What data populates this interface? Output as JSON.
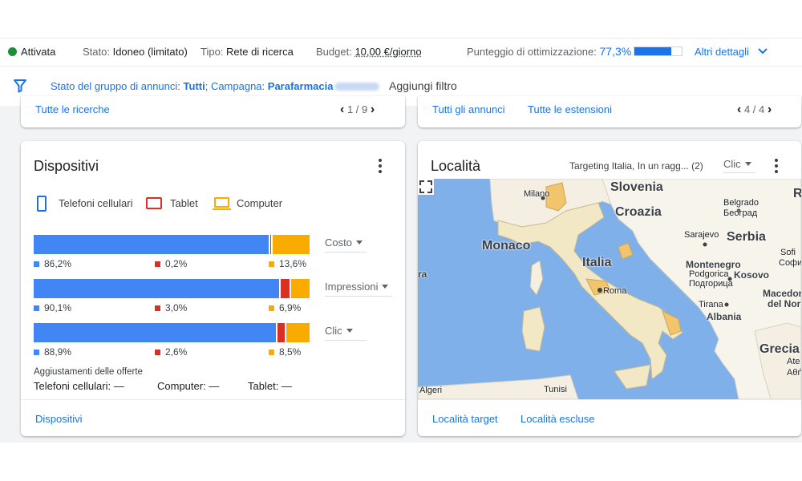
{
  "status_bar": {
    "status_label": "Attivata",
    "state_label": "Stato:",
    "state_value": "Idoneo (limitato)",
    "type_label": "Tipo:",
    "type_value": "Rete di ricerca",
    "budget_label": "Budget:",
    "budget_value": "10,00 €/giorno",
    "optimization_label": "Punteggio di ottimizzazione:",
    "optimization_value": "77,3%",
    "optimization_fraction": 0.773,
    "more_details": "Altri dettagli"
  },
  "filter_bar": {
    "prefix": "Stato del gruppo di annunci:",
    "group_status": "Tutti",
    "campaign_label": "; Campagna:",
    "campaign_name": "Parafarmacia",
    "add_filter": "Aggiungi filtro"
  },
  "top_cards": {
    "left_link": "Tutte le ricerche",
    "left_pager": "1 / 9",
    "right_link_1": "Tutti gli annunci",
    "right_link_2": "Tutte le estensioni",
    "right_pager": "4 / 4"
  },
  "devices_card": {
    "title": "Dispositivi",
    "legend": {
      "mobile": "Telefoni cellulari",
      "tablet": "Tablet",
      "computer": "Computer"
    },
    "metrics": [
      {
        "name": "Costo",
        "mobile": "86,2%",
        "tablet": "0,2%",
        "computer": "13,6%"
      },
      {
        "name": "Impressioni",
        "mobile": "90,1%",
        "tablet": "3,0%",
        "computer": "6,9%"
      },
      {
        "name": "Clic",
        "mobile": "88,9%",
        "tablet": "2,6%",
        "computer": "8,5%"
      }
    ],
    "adjustments_title": "Aggiustamenti delle offerte",
    "adjustments": {
      "mobile": "Telefoni cellulari: —",
      "computer": "Computer: —",
      "tablet": "Tablet: —"
    },
    "footer_link": "Dispositivi"
  },
  "chart_data": {
    "type": "bar",
    "categories": [
      "Costo",
      "Impressioni",
      "Clic"
    ],
    "series": [
      {
        "name": "Telefoni cellulari",
        "values": [
          86.2,
          90.1,
          88.9
        ]
      },
      {
        "name": "Tablet",
        "values": [
          0.2,
          3.0,
          2.6
        ]
      },
      {
        "name": "Computer",
        "values": [
          13.6,
          6.9,
          8.5
        ]
      }
    ],
    "stacked": true,
    "orientation": "horizontal",
    "colors": [
      "#4285f4",
      "#d93025",
      "#f9ab00"
    ]
  },
  "location_card": {
    "title": "Località",
    "targeting": "Targeting Italia, In un ragg... (2)",
    "metric_select": "Clic",
    "map_labels": {
      "slovenia": "Slovenia",
      "croazia": "Croazia",
      "serbia": "Serbia",
      "italia": "Italia",
      "monaco": "Monaco",
      "milano": "Milano",
      "roma": "Roma",
      "belgrado": "Belgrado",
      "beograd": "Београд",
      "sarajevo": "Sarajevo",
      "montenegro": "Montenegro",
      "podgorica": "Podgorica",
      "podgorica_cyr": "Подгорица",
      "kosovo": "Kosovo",
      "macedonia": "Macedonia",
      "del_nord": "del Nord",
      "tirana": "Tirana",
      "albania": "Albania",
      "grecia": "Grecia",
      "sofia": "Sofi",
      "sofia_cyr": "Софи",
      "algeri": "Algeri",
      "tunisi": "Tunisi",
      "ra": "ra",
      "r": "R",
      "ate": "Ate",
      "ath": "Αθή"
    },
    "footer_target": "Località target",
    "footer_excluded": "Località escluse"
  },
  "colors": {
    "accent": "#1a73e8",
    "active_green": "#1e8e3e",
    "mobile": "#4285f4",
    "tablet": "#d93025",
    "computer": "#f9ab00",
    "sea": "#7fb0ea",
    "land": "#f7f4ec",
    "italy_region": "#f3e8c6",
    "highlight": "#f2c46b"
  }
}
